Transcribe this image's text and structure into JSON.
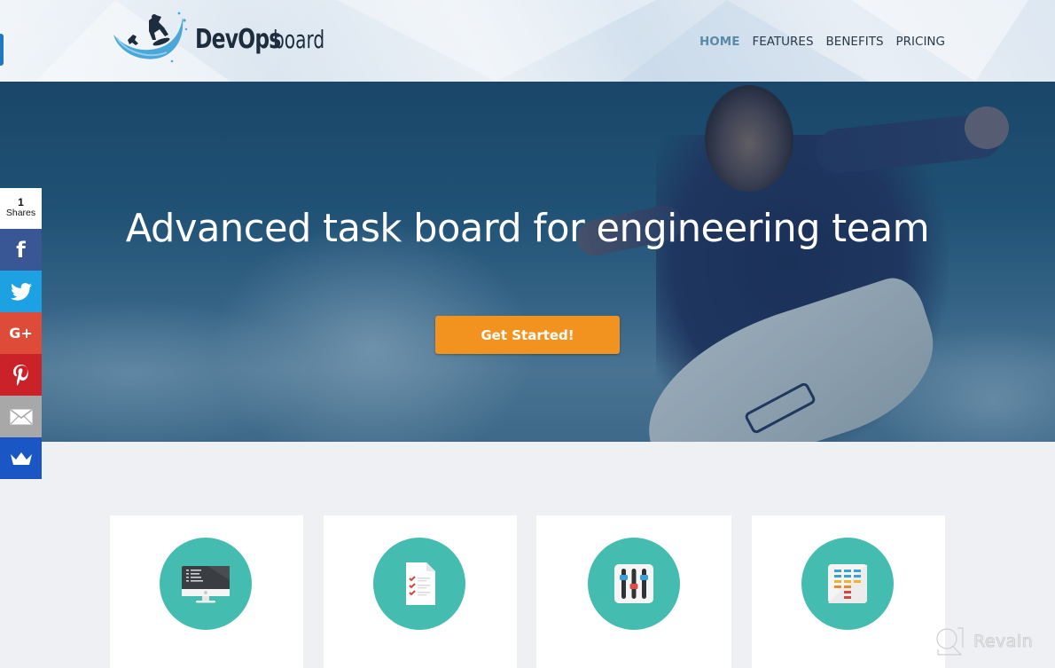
{
  "header": {
    "logo": {
      "brand_bold": "DevOps",
      "brand_light": "board"
    },
    "nav": [
      {
        "label": "HOME",
        "active": true
      },
      {
        "label": "FEATURES",
        "active": false
      },
      {
        "label": "BENEFITS",
        "active": false
      },
      {
        "label": "PRICING",
        "active": false
      }
    ]
  },
  "hero": {
    "title": "Advanced task board for engineering team",
    "cta_label": "Get Started!"
  },
  "share": {
    "count": "1",
    "count_label": "Shares",
    "buttons": [
      {
        "network": "facebook",
        "icon": "facebook-icon",
        "glyph": "f",
        "color": "#3a5795"
      },
      {
        "network": "twitter",
        "icon": "twitter-icon",
        "glyph": "",
        "color": "#1da1e2"
      },
      {
        "network": "google-plus",
        "icon": "google-plus-icon",
        "glyph": "G+",
        "color": "#de4b39"
      },
      {
        "network": "pinterest",
        "icon": "pinterest-icon",
        "glyph": "P",
        "color": "#cb2128"
      },
      {
        "network": "email",
        "icon": "email-icon",
        "glyph": "",
        "color": "#a8a8a8"
      },
      {
        "network": "sumo",
        "icon": "crown-icon",
        "glyph": "",
        "color": "#1b57c4"
      }
    ]
  },
  "features": [
    {
      "icon": "code-monitor-icon"
    },
    {
      "icon": "checklist-document-icon"
    },
    {
      "icon": "equalizer-sliders-icon"
    },
    {
      "icon": "kanban-board-icon"
    }
  ],
  "colors": {
    "accent": "#f2921f",
    "feature_circle": "#45bcb0",
    "nav_active": "#5b8aa8"
  },
  "watermark": {
    "text": "Revain"
  }
}
